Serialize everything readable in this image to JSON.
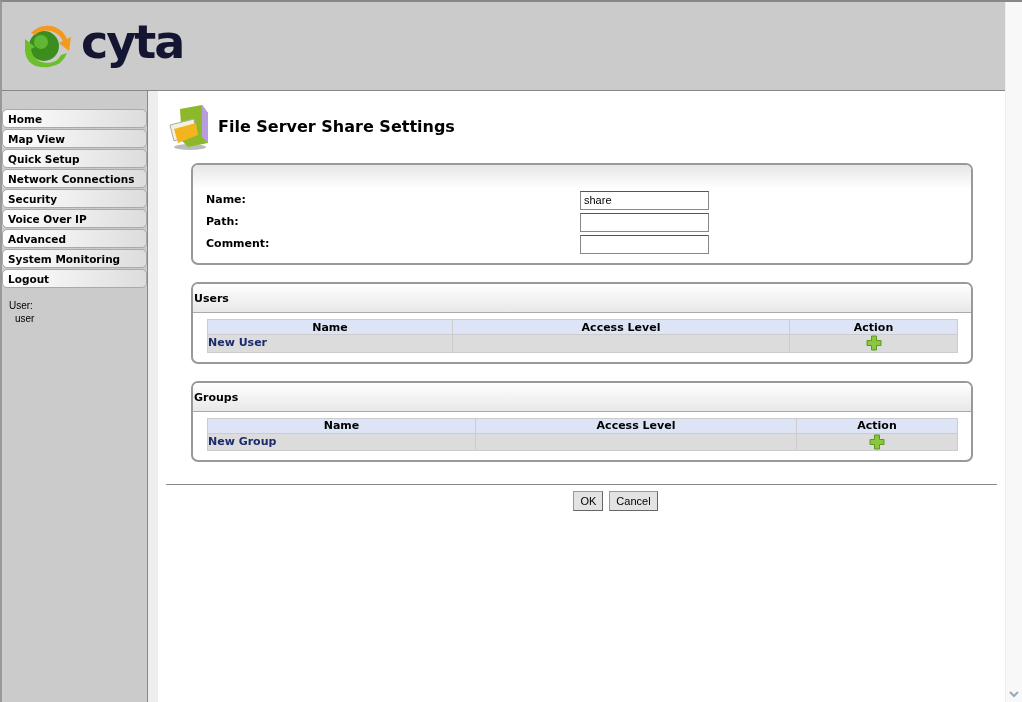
{
  "header": {
    "logo_text": "cyta"
  },
  "sidebar": {
    "items": [
      {
        "label": "Home",
        "selected": false
      },
      {
        "label": "Map View",
        "selected": false
      },
      {
        "label": "Quick Setup",
        "selected": false
      },
      {
        "label": "Network Connections",
        "selected": false
      },
      {
        "label": "Security",
        "selected": false
      },
      {
        "label": "Voice Over IP",
        "selected": false
      },
      {
        "label": "Advanced",
        "selected": false
      },
      {
        "label": "System Monitoring",
        "selected": false
      },
      {
        "label": "Logout",
        "selected": false
      }
    ],
    "user_label": "User:",
    "user_name": "user"
  },
  "page": {
    "title": "File Server Share Settings"
  },
  "form": {
    "fields": [
      {
        "label": "Name:",
        "value": "share"
      },
      {
        "label": "Path:"
      },
      {
        "label": "Comment:"
      }
    ]
  },
  "panels": [
    {
      "title": "Users",
      "columns": [
        "Name",
        "Access Level",
        "Action"
      ],
      "rows": [
        {
          "name": "New User"
        }
      ]
    },
    {
      "title": "Groups",
      "columns": [
        "Name",
        "Access Level",
        "Action"
      ],
      "rows": [
        {
          "name": "New Group"
        }
      ]
    }
  ],
  "buttons": [
    "OK",
    "Cancel"
  ]
}
